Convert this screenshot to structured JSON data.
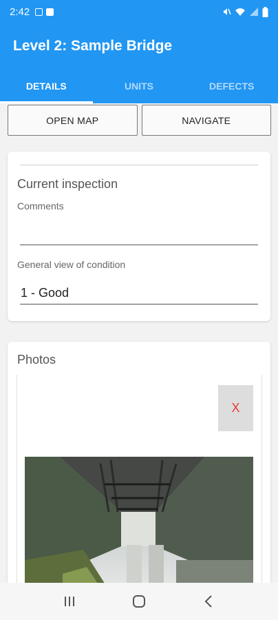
{
  "status_bar": {
    "time": "2:42",
    "left_icons": [
      "image-icon",
      "checkbox-icon"
    ],
    "right_icons": [
      "mute-icon",
      "wifi-icon",
      "signal-icon",
      "battery-icon"
    ]
  },
  "app_bar": {
    "title": "Level 2: Sample Bridge"
  },
  "tabs": [
    {
      "label": "DETAILS",
      "active": true
    },
    {
      "label": "UNITS",
      "active": false
    },
    {
      "label": "DEFECTS",
      "active": false
    }
  ],
  "actions": {
    "open_map": "OPEN MAP",
    "navigate": "NAVIGATE"
  },
  "inspection": {
    "title": "Current inspection",
    "comments_label": "Comments",
    "comments_value": "",
    "condition_label": "General view of condition",
    "condition_value": "1 - Good"
  },
  "photos": {
    "title": "Photos",
    "delete_label": "X"
  },
  "colors": {
    "primary": "#2196f3",
    "delete": "#e33333"
  },
  "nav_bar": {
    "icons": [
      "recents-icon",
      "home-icon",
      "back-icon"
    ]
  }
}
